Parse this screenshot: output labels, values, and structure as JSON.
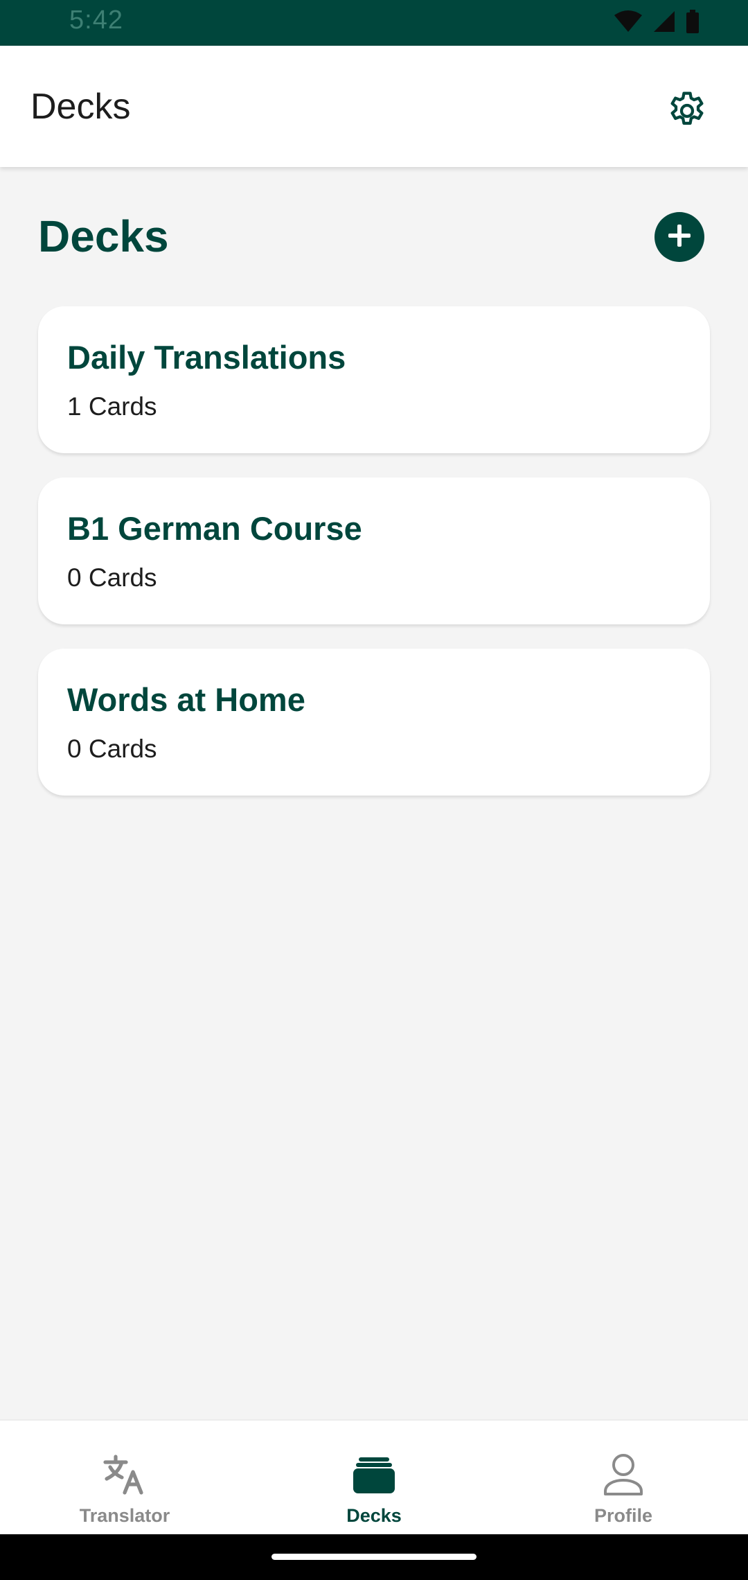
{
  "status_bar": {
    "time": "5:42"
  },
  "app_bar": {
    "title": "Decks",
    "settings_icon": "gear-icon"
  },
  "section": {
    "title": "Decks",
    "add_icon": "plus-icon"
  },
  "decks": [
    {
      "name": "Daily Translations",
      "count": "1 Cards"
    },
    {
      "name": "B1 German Course",
      "count": "0 Cards"
    },
    {
      "name": "Words at Home",
      "count": "0 Cards"
    }
  ],
  "bottom_nav": {
    "items": [
      {
        "label": "Translator",
        "icon": "translate-icon",
        "active": false
      },
      {
        "label": "Decks",
        "icon": "decks-icon",
        "active": true
      },
      {
        "label": "Profile",
        "icon": "person-icon",
        "active": false
      }
    ]
  },
  "colors": {
    "brand": "#00463c",
    "background": "#f4f4f4",
    "card": "#ffffff",
    "inactive": "#8a8a8a"
  }
}
